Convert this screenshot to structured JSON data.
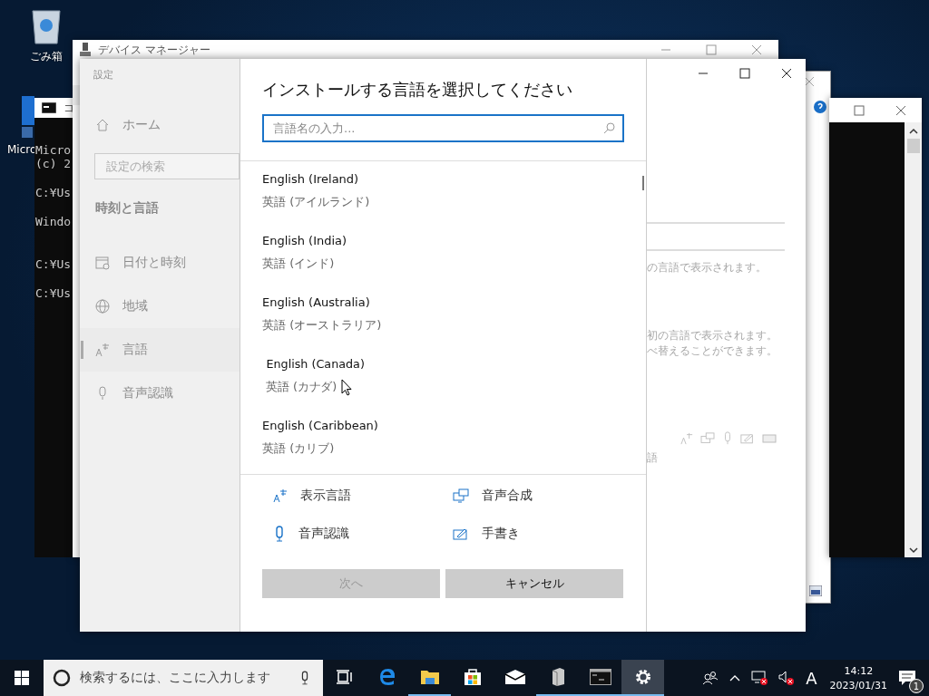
{
  "desktop_icons": [
    {
      "kind": "recycle",
      "label": "ごみ箱"
    },
    {
      "kind": "shortcut",
      "label": "Micro"
    }
  ],
  "cmd_left": {
    "title": "コ",
    "blocks": [
      [
        "Micro",
        "(c) 2"
      ],
      [
        "C:¥Us"
      ],
      [
        "Windo"
      ],
      [
        "C:¥Us"
      ],
      [
        "C:¥Us"
      ]
    ]
  },
  "device_manager": {
    "title": "デバイス マネージャー"
  },
  "settings": {
    "title": "設定",
    "home": "ホーム",
    "search_placeholder": "設定の検索",
    "section": "時刻と言語",
    "nav": [
      {
        "kind": "calendar",
        "label": "日付と時刻",
        "selected": false
      },
      {
        "kind": "globe",
        "label": "地域",
        "selected": false
      },
      {
        "kind": "language",
        "label": "言語",
        "selected": true
      },
      {
        "kind": "mic",
        "label": "音声認識",
        "selected": false
      }
    ],
    "background_texts": [
      "の言語で表示されます。",
      "初の言語で表示されます。",
      "べ替えることができます。",
      "語"
    ]
  },
  "dialog": {
    "title": "インストールする言語を選択してください",
    "search": {
      "placeholder": "言語名の入力..."
    },
    "languages": [
      {
        "name": "English (Ireland)",
        "native": "英語 (アイルランド)",
        "pressed": false
      },
      {
        "name": "English (India)",
        "native": "英語 (インド)",
        "pressed": false
      },
      {
        "name": "English (Australia)",
        "native": "英語 (オーストラリア)",
        "pressed": false
      },
      {
        "name": "English (Canada)",
        "native": "英語 (カナダ)",
        "pressed": true
      },
      {
        "name": "English (Caribbean)",
        "native": "英語 (カリブ)",
        "pressed": false
      }
    ],
    "features": [
      {
        "kind": "display",
        "label": "表示言語"
      },
      {
        "kind": "speech",
        "label": "音声合成"
      },
      {
        "kind": "mic",
        "label": "音声認識"
      },
      {
        "kind": "handwriting",
        "label": "手書き"
      }
    ],
    "buttons": [
      {
        "label": "次へ",
        "disabled": true
      },
      {
        "label": "キャンセル",
        "disabled": false
      }
    ]
  },
  "taskbar": {
    "search_placeholder": "検索するには、ここに入力します",
    "apps": [
      {
        "kind": "taskview",
        "active": false,
        "running": false
      },
      {
        "kind": "edge",
        "active": false,
        "running": false
      },
      {
        "kind": "explorer",
        "active": false,
        "running": true
      },
      {
        "kind": "store",
        "active": false,
        "running": false
      },
      {
        "kind": "mail",
        "active": false,
        "running": false
      },
      {
        "kind": "server",
        "active": false,
        "running": true
      },
      {
        "kind": "cmd",
        "active": false,
        "running": true
      },
      {
        "kind": "settings",
        "active": true,
        "running": true
      }
    ],
    "ime": "A",
    "time": "14:12",
    "date": "2023/01/31",
    "notifications": "1"
  }
}
